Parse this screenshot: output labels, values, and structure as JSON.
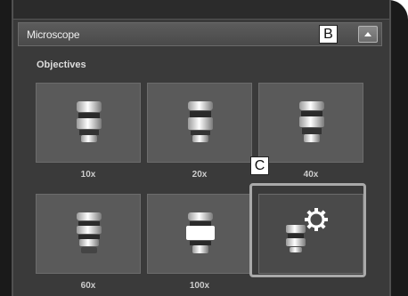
{
  "section": {
    "title": "Microscope",
    "collapse_icon": "chevron-up-icon"
  },
  "objectives": {
    "label": "Objectives",
    "buttons": [
      {
        "label": "10x",
        "icon": "objective-lens-icon"
      },
      {
        "label": "20x",
        "icon": "objective-lens-icon"
      },
      {
        "label": "40x",
        "icon": "objective-lens-icon"
      },
      {
        "label": "60x",
        "icon": "objective-lens-icon"
      },
      {
        "label": "100x",
        "icon": "objective-lens-icon"
      },
      {
        "label": "",
        "icon": "objective-settings-icon"
      }
    ]
  },
  "callouts": {
    "b": "B",
    "c": "C"
  },
  "colors": {
    "panel": "#3a3a3a",
    "button": "#5a5a5a",
    "highlight": "#a9a9a9"
  }
}
